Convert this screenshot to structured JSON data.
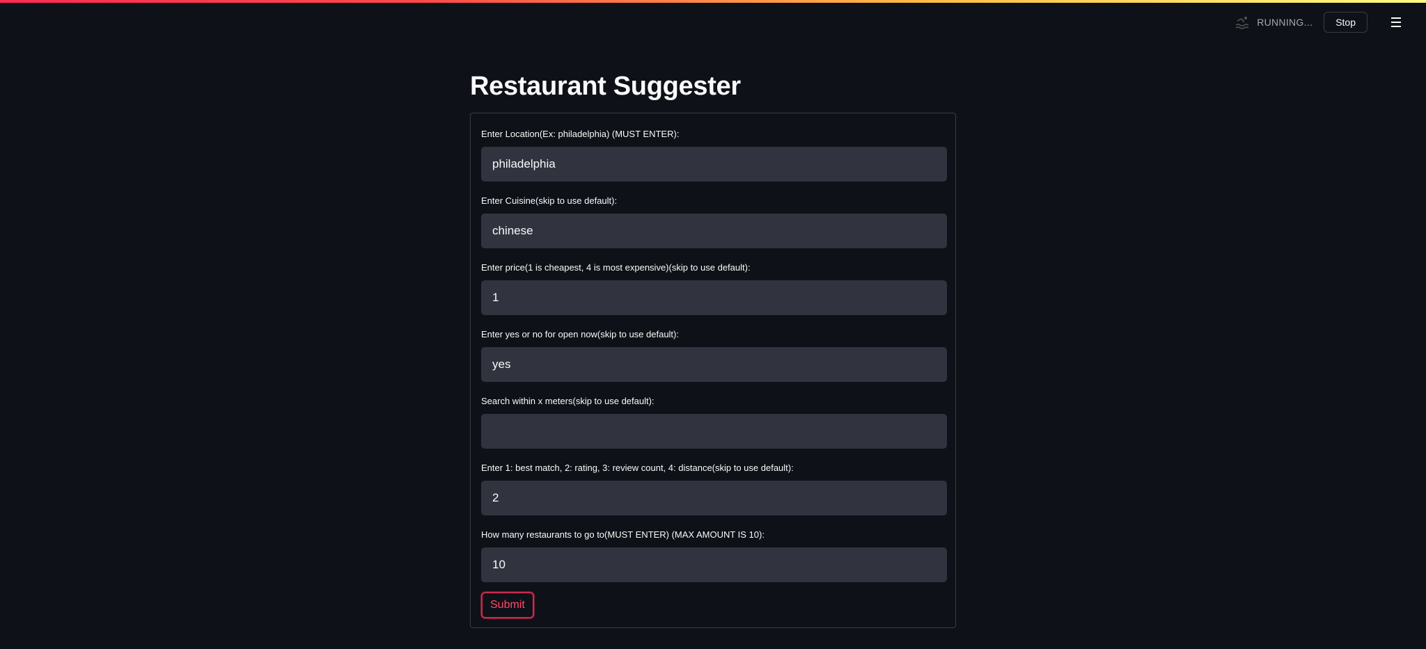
{
  "app": {
    "status_text": "RUNNING...",
    "stop_label": "Stop",
    "running_icon": "swimmer-icon",
    "menu_icon": "hamburger-menu-icon"
  },
  "page": {
    "title": "Restaurant Suggester"
  },
  "form": {
    "fields": [
      {
        "label": "Enter Location(Ex: philadelphia) (MUST ENTER):",
        "value": "philadelphia",
        "placeholder": ""
      },
      {
        "label": "Enter Cuisine(skip to use default):",
        "value": "chinese",
        "placeholder": ""
      },
      {
        "label": "Enter price(1 is cheapest, 4 is most expensive)(skip to use default):",
        "value": "1",
        "placeholder": ""
      },
      {
        "label": "Enter yes or no for open now(skip to use default):",
        "value": "yes",
        "placeholder": ""
      },
      {
        "label": "Search within x meters(skip to use default):",
        "value": "",
        "placeholder": ""
      },
      {
        "label": "Enter 1: best match, 2: rating, 3: review count, 4: distance(skip to use default):",
        "value": "2",
        "placeholder": ""
      },
      {
        "label": "How many restaurants to go to(MUST ENTER) (MAX AMOUNT IS 10):",
        "value": "10",
        "placeholder": ""
      }
    ],
    "submit_label": "Submit"
  },
  "colors": {
    "background": "#0e1117",
    "input_bg": "#31333f",
    "accent": "#ff4b4b",
    "decoration_gradient": [
      "#ff2b56",
      "#ff4b4b",
      "#ffbd45",
      "#fffd80"
    ]
  }
}
